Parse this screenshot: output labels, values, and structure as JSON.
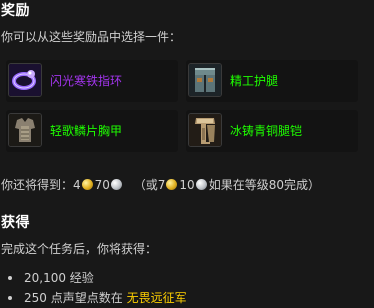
{
  "rewards_section": {
    "title": "奖励",
    "instruction": "你可以从这些奖励品中选择一件：",
    "items": [
      {
        "name": "闪光寒铁指环",
        "color": "#a335ee",
        "icon": "ring-icon"
      },
      {
        "name": "精工护腿",
        "color": "#1eff00",
        "icon": "leggings-icon"
      },
      {
        "name": "轻歌鳞片胸甲",
        "color": "#1eff00",
        "icon": "chest-armor-icon"
      },
      {
        "name": "冰铸青铜腿铠",
        "color": "#1eff00",
        "icon": "leg-plate-icon"
      }
    ]
  },
  "money": {
    "prefix": "你还将得到：",
    "gold": "4",
    "silver": "70",
    "alt_open": "（或",
    "alt_gold": "7",
    "alt_silver": "10",
    "alt_suffix": "如果在等级80完成）"
  },
  "gains_section": {
    "title": "获得",
    "intro": "完成这个任务后，你将获得：",
    "experience": "20,100 经验",
    "reputation_prefix": "250 点声望点数在",
    "reputation_faction": "无畏远征军",
    "faction_color": "#ffd100"
  }
}
